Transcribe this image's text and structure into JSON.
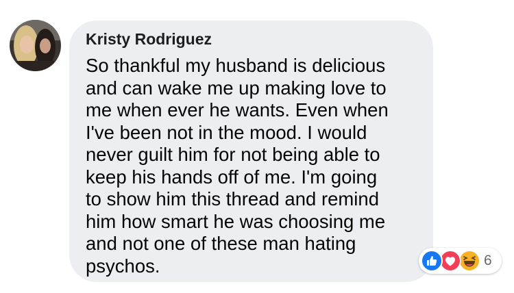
{
  "comment": {
    "author": "Kristy Rodriguez",
    "text": "So thankful my husband is delicious\nand can wake me up making love to\nme when ever he wants. Even when\nI've been not in the mood. I would\nnever guilt him for not being able to\nkeep his hands off of me. I'm going\nto show him this thread and remind\nhim how smart he was choosing me\nand not one of these man hating\npsychos.",
    "reaction_count": "6",
    "reactions": [
      "like-icon",
      "love-icon",
      "haha-icon"
    ]
  },
  "colors": {
    "bubble": "#eceef1",
    "like": "#1877f2",
    "love": "#f33e58",
    "haha": "#f7b125"
  }
}
